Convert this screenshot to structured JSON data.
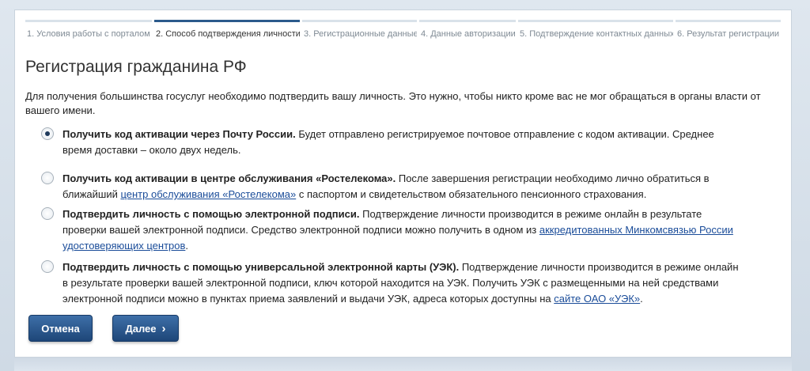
{
  "steps": [
    {
      "label": "1. Условия работы с порталом"
    },
    {
      "label": "2. Способ подтверждения личности"
    },
    {
      "label": "3. Регистрационные данные"
    },
    {
      "label": "4. Данные авторизации"
    },
    {
      "label": "5. Подтверждение контактных данных"
    },
    {
      "label": "6. Результат регистрации"
    }
  ],
  "active_step": 2,
  "title": "Регистрация гражданина РФ",
  "intro": "Для получения большинства госуслуг необходимо подтвердить вашу личность. Это нужно, чтобы никто кроме вас не мог обращаться в органы власти от вашего имени.",
  "options": [
    {
      "selected": true,
      "bold": "Получить код активации через Почту России.",
      "text": " Будет отправлено регистрируемое почтовое отправление с кодом активации. Среднее время доставки – около двух недель."
    },
    {
      "selected": false,
      "bold": "Получить код активации в центре обслуживания «Ростелекома».",
      "text": " После завершения регистрации необходимо лично обратиться в ближайший ",
      "link": "центр обслуживания «Ростелекома»",
      "text_after": " с паспортом и свидетельством обязательного пенсионного страхования."
    },
    {
      "selected": false,
      "bold": "Подтвердить личность с помощью электронной подписи.",
      "text": " Подтверждение личности производится в режиме онлайн в результате проверки вашей электронной подписи. Средство электронной подписи можно получить в одном из ",
      "link": "аккредитованных Минкомсвязью России удостоверяющих центров",
      "text_after": "."
    },
    {
      "selected": false,
      "bold": "Подтвердить личность с помощью универсальной электронной карты (УЭК).",
      "text": " Подтверждение личности производится в режиме онлайн в результате проверки вашей электронной подписи, ключ которой находится на УЭК. Получить УЭК с размещенными на ней средствами электронной подписи можно в пунктах приема заявлений и выдачи УЭК, адреса которых доступны на ",
      "link": "сайте ОАО «УЭК»",
      "text_after": "."
    }
  ],
  "buttons": {
    "cancel": "Отмена",
    "next": "Далее"
  },
  "icons": {
    "next_chevron": "chevron-right-icon"
  },
  "colors": {
    "accent": "#2b5a8c",
    "link": "#1a4c99",
    "button": "#2a5a94"
  }
}
